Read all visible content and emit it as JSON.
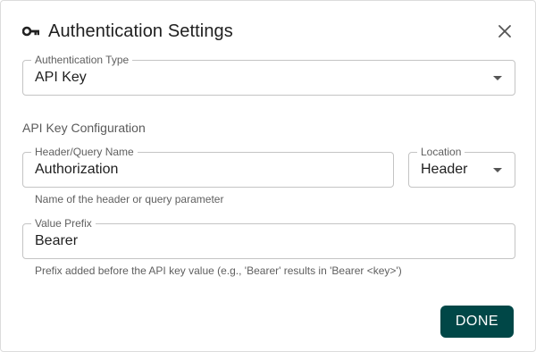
{
  "dialog": {
    "title": "Authentication Settings",
    "close_icon": "close-icon",
    "title_icon": "key-icon"
  },
  "auth_type": {
    "label": "Authentication Type",
    "value": "API Key"
  },
  "api_key_config": {
    "section_title": "API Key Configuration",
    "header_name": {
      "label": "Header/Query Name",
      "value": "Authorization",
      "helper": "Name of the header or query parameter"
    },
    "location": {
      "label": "Location",
      "value": "Header"
    },
    "value_prefix": {
      "label": "Value Prefix",
      "value": "Bearer",
      "helper": "Prefix added before the API key value (e.g., 'Bearer' results in 'Bearer <key>')"
    }
  },
  "actions": {
    "done_label": "DONE"
  },
  "colors": {
    "primary_button": "#004747",
    "border": "#c4c4c4"
  }
}
